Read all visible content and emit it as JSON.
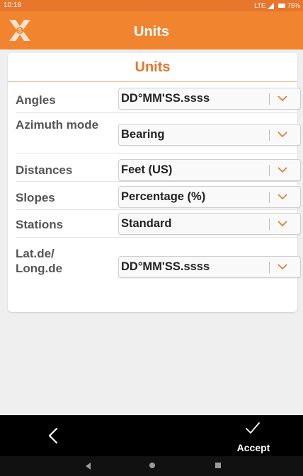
{
  "status_bar": {
    "time": "10:18",
    "network": "LTE",
    "battery": "75%"
  },
  "header": {
    "title": "Units",
    "logo_icon": "x-logo-icon",
    "accent_color": "#f0842f"
  },
  "card": {
    "title": "Units",
    "rows": [
      {
        "label": "Angles",
        "value": "DD°MM'SS.ssss"
      },
      {
        "label": "Azimuth mode",
        "value": "Bearing"
      },
      {
        "label": "Distances",
        "value": "Feet (US)"
      },
      {
        "label": "Slopes",
        "value": "Percentage (%)"
      },
      {
        "label": "Stations",
        "value": "Standard"
      },
      {
        "label": "Lat.de/ Long.de",
        "value": "DD°MM'SS.ssss"
      }
    ]
  },
  "footer": {
    "back_icon": "chevron-left-icon",
    "accept_icon": "check-icon",
    "accept_label": "Accept"
  }
}
